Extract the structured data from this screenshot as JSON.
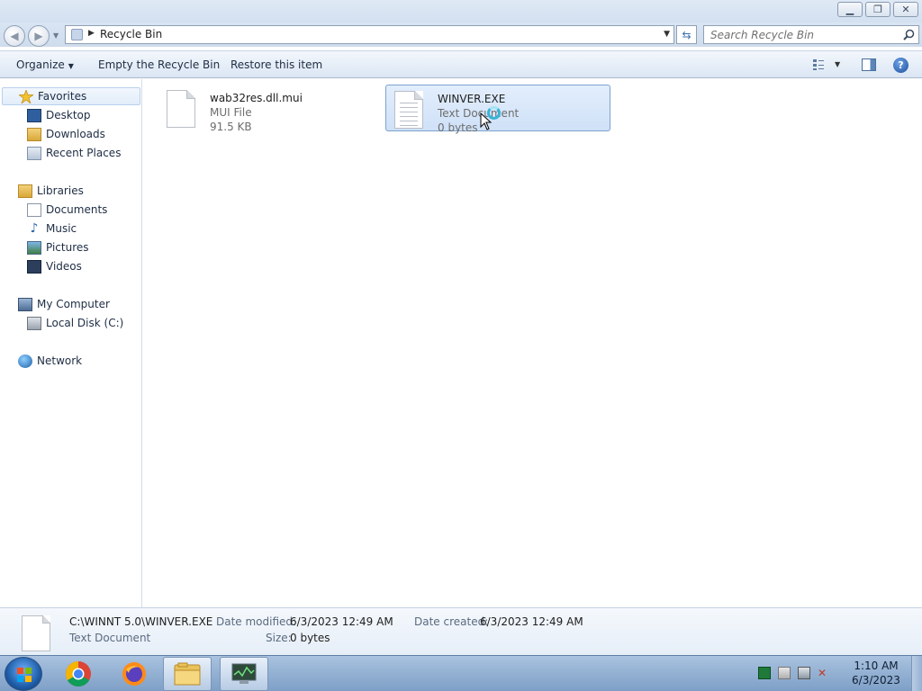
{
  "window": {
    "caption_buttons": {
      "minimize_icon": "minimize-icon",
      "restore_icon": "restore-icon",
      "close_icon": "close-icon"
    }
  },
  "address": {
    "location": "Recycle Bin",
    "search_placeholder": "Search Recycle Bin"
  },
  "toolbar": {
    "organize_label": "Organize",
    "empty_label": "Empty the Recycle Bin",
    "restore_label": "Restore this item"
  },
  "nav": {
    "favorites": {
      "label": "Favorites",
      "items": [
        {
          "label": "Desktop",
          "icon": "desktop-icon"
        },
        {
          "label": "Downloads",
          "icon": "downloads-folder-icon"
        },
        {
          "label": "Recent Places",
          "icon": "recent-places-icon"
        }
      ]
    },
    "libraries": {
      "label": "Libraries",
      "items": [
        {
          "label": "Documents",
          "icon": "documents-icon"
        },
        {
          "label": "Music",
          "icon": "music-icon"
        },
        {
          "label": "Pictures",
          "icon": "pictures-icon"
        },
        {
          "label": "Videos",
          "icon": "videos-icon"
        }
      ]
    },
    "computer": {
      "label": "My Computer",
      "items": [
        {
          "label": "Local Disk (C:)",
          "icon": "local-disk-icon"
        }
      ]
    },
    "network": {
      "label": "Network"
    }
  },
  "files": [
    {
      "name": "wab32res.dll.mui",
      "type": "MUI File",
      "size": "91.5 KB",
      "selected": false
    },
    {
      "name": "WINVER.EXE",
      "type": "Text Document",
      "size": "0 bytes",
      "selected": true
    }
  ],
  "details": {
    "path": "C:\\WINNT 5.0\\WINVER.EXE",
    "type": "Text Document",
    "modified_label": "Date modified:",
    "modified_value": "6/3/2023 12:49 AM",
    "created_label": "Date created:",
    "created_value": "6/3/2023 12:49 AM",
    "size_label": "Size:",
    "size_value": "0 bytes"
  },
  "taskbar": {
    "apps": [
      "start-button",
      "chrome",
      "firefox",
      "windows-explorer",
      "system-monitor"
    ],
    "clock_time": "1:10 AM",
    "clock_date": "6/3/2023"
  },
  "colors": {
    "selection": "#cfe1f8",
    "selection_border": "#7da2ce",
    "taskbar": "#8eabcf"
  }
}
